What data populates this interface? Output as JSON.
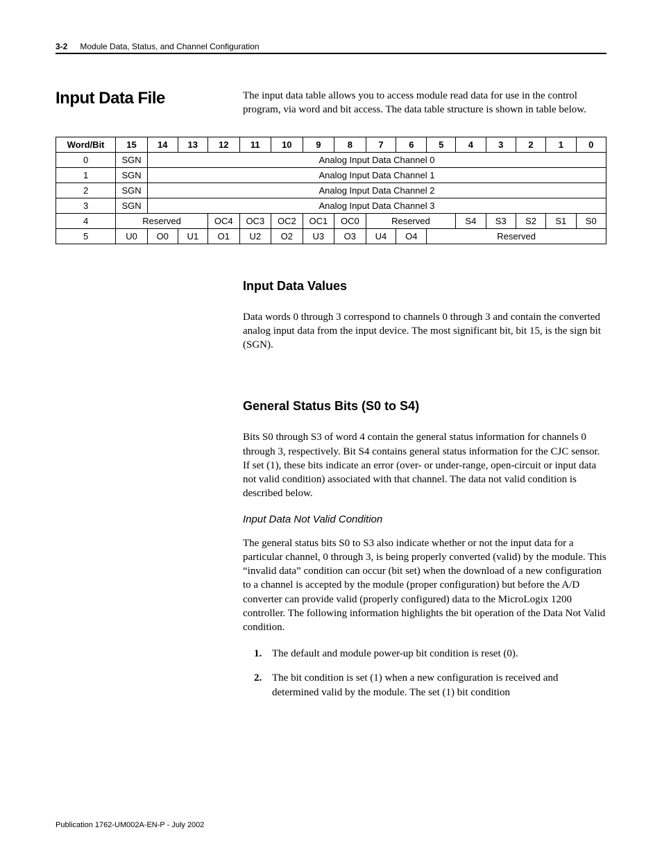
{
  "header": {
    "page_number": "3-2",
    "chapter_title": "Module Data, Status, and Channel Configuration"
  },
  "section_title": "Input Data File",
  "intro_paragraph": "The input data table allows you to access module read data for use in the control program, via word and bit access. The data table structure is shown in table below.",
  "table": {
    "head": [
      "Word/Bit",
      "15",
      "14",
      "13",
      "12",
      "11",
      "10",
      "9",
      "8",
      "7",
      "6",
      "5",
      "4",
      "3",
      "2",
      "1",
      "0"
    ],
    "row0": {
      "word": "0",
      "sgn": "SGN",
      "span": "Analog Input Data Channel 0"
    },
    "row1": {
      "word": "1",
      "sgn": "SGN",
      "span": "Analog Input Data Channel 1"
    },
    "row2": {
      "word": "2",
      "sgn": "SGN",
      "span": "Analog Input Data Channel 2"
    },
    "row3": {
      "word": "3",
      "sgn": "SGN",
      "span": "Analog Input Data Channel 3"
    },
    "row4": {
      "word": "4",
      "reserved1": "Reserved",
      "oc4": "OC4",
      "oc3": "OC3",
      "oc2": "OC2",
      "oc1": "OC1",
      "oc0": "OC0",
      "reserved2": "Reserved",
      "s4": "S4",
      "s3": "S3",
      "s2": "S2",
      "s1": "S1",
      "s0": "S0"
    },
    "row5": {
      "word": "5",
      "u0a": "U0",
      "o0": "O0",
      "u1": "U1",
      "o1": "O1",
      "u2": "U2",
      "o2": "O2",
      "u3": "U3",
      "o3": "O3",
      "u4": "U4",
      "o4": "O4",
      "reserved": "Reserved"
    }
  },
  "sections": {
    "input_data_values": {
      "heading": "Input Data Values",
      "para": "Data words 0 through 3 correspond to channels 0 through 3 and contain the converted analog input data from the input device. The most significant bit, bit 15, is the sign bit (SGN)."
    },
    "general_status": {
      "heading": "General Status Bits (S0 to S4)",
      "para": "Bits S0 through S3 of word 4 contain the general status information for channels 0 through 3, respectively. Bit S4 contains general status information for the CJC sensor. If set (1), these bits indicate an error (over- or under-range, open-circuit or input data not valid condition) associated with that channel. The data not valid condition is described below.",
      "sub_heading": "Input Data Not Valid Condition",
      "sub_para": "The general status bits S0 to S3 also indicate whether or not the input data for a particular channel, 0 through 3, is being properly converted (valid) by the module. This “invalid data” condition can occur (bit set) when the download of a new configuration to a channel is accepted by the module (proper configuration) but before the A/D converter can provide valid (properly configured) data to the MicroLogix 1200 controller. The following information highlights the bit operation of the Data Not Valid condition.",
      "list": {
        "n1": "1.",
        "t1": "The default and module power-up bit condition is reset (0).",
        "n2": "2.",
        "t2": "The bit condition is set (1) when a new configuration is received and determined valid by the module. The set (1) bit condition"
      }
    }
  },
  "footer": "Publication 1762-UM002A-EN-P - July 2002"
}
